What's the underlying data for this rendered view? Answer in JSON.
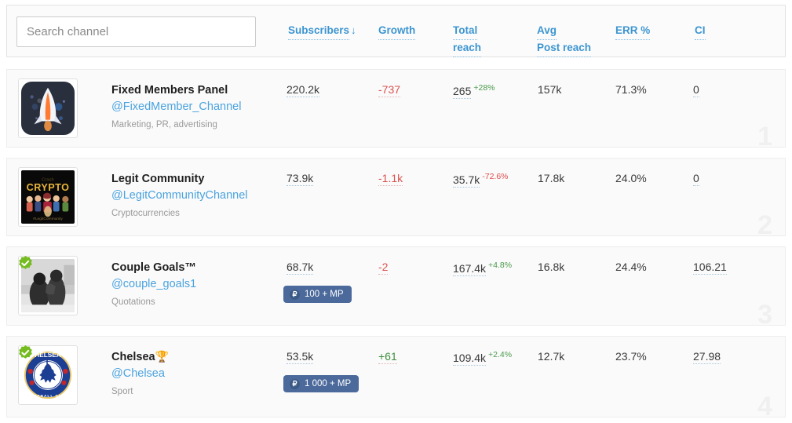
{
  "search": {
    "placeholder": "Search channel",
    "value": ""
  },
  "columns": {
    "subscribers": "Subscribers",
    "subscribers_sort": "↓",
    "growth": "Growth",
    "total_reach_line1": "Total",
    "total_reach_line2": "reach",
    "avg_line1": "Avg",
    "avg_line2": "Post reach",
    "err": "ERR %",
    "ci": "CI"
  },
  "colors": {
    "link": "#3c95d1",
    "handle": "#4aa3df",
    "negative": "#d9534f",
    "positive": "#3f8f3f",
    "badge_bg": "#4b6a9b"
  },
  "rows": [
    {
      "rank": "1",
      "title": "Fixed Members Panel",
      "title_emoji": "",
      "handle": "@FixedMember_Channel",
      "category": "Marketing, PR, advertising",
      "verified": false,
      "avatar": "rocket-dark-avatar",
      "subscribers": "220.2k",
      "growth": "-737",
      "growth_sign": "neg",
      "total_reach": "265",
      "total_reach_delta": "+28%",
      "total_reach_delta_dir": "up",
      "avg_post_reach": "157k",
      "err": "71.3%",
      "ci": "0",
      "mp_badge": null
    },
    {
      "rank": "2",
      "title": "Legit Community",
      "title_emoji": "",
      "handle": "@LegitCommunityChannel",
      "category": "Cryptocurrencies",
      "verified": false,
      "avatar": "crypto-community-avatar",
      "subscribers": "73.9k",
      "growth": "-1.1k",
      "growth_sign": "neg",
      "total_reach": "35.7k",
      "total_reach_delta": "-72.6%",
      "total_reach_delta_dir": "down",
      "avg_post_reach": "17.8k",
      "err": "24.0%",
      "ci": "0",
      "mp_badge": null
    },
    {
      "rank": "3",
      "title": "Couple Goals™",
      "title_emoji": "",
      "handle": "@couple_goals1",
      "category": "Quotations",
      "verified": true,
      "avatar": "couple-photo-avatar",
      "subscribers": "68.7k",
      "growth": "-2",
      "growth_sign": "neg",
      "total_reach": "167.4k",
      "total_reach_delta": "+4.8%",
      "total_reach_delta_dir": "up",
      "avg_post_reach": "16.8k",
      "err": "24.4%",
      "ci": "106.21",
      "mp_badge": "100 + MP",
      "mp_coin": "₽"
    },
    {
      "rank": "4",
      "title": "Chelsea",
      "title_emoji": "🏆",
      "handle": "@Chelsea",
      "category": "Sport",
      "verified": true,
      "avatar": "chelsea-crest-avatar",
      "subscribers": "53.5k",
      "growth": "+61",
      "growth_sign": "pos",
      "total_reach": "109.4k",
      "total_reach_delta": "+2.4%",
      "total_reach_delta_dir": "up",
      "avg_post_reach": "12.7k",
      "err": "23.7%",
      "ci": "27.98",
      "mp_badge": "1 000 + MP",
      "mp_coin": "₽"
    }
  ]
}
